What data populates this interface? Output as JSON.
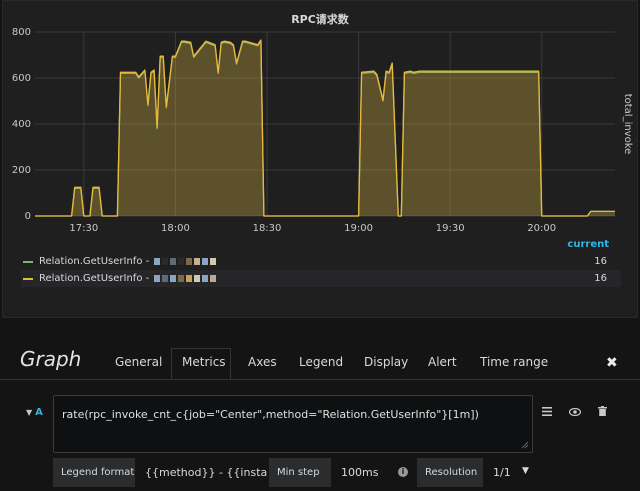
{
  "panel": {
    "title": "RPC请求数",
    "y2_label": "total_invoke",
    "legend_header": "current"
  },
  "chart_data": {
    "type": "area",
    "title": "RPC请求数",
    "ylabel": "total_invoke",
    "xlabel": "",
    "ylim": [
      0,
      800
    ],
    "y_ticks": [
      "0",
      "200",
      "400",
      "600",
      "800"
    ],
    "x_ticks": [
      "17:30",
      "18:00",
      "18:30",
      "19:00",
      "19:30",
      "20:00"
    ],
    "x_range": [
      "17:14",
      "20:24"
    ],
    "grid": true,
    "legend_placement": "bottom",
    "series": [
      {
        "name": "Relation.GetUserInfo -",
        "color": "#7eb26d",
        "current": "16",
        "x": [
          "17:14",
          "17:26",
          "17:27",
          "17:29",
          "17:30",
          "17:32",
          "17:33",
          "17:35",
          "17:36",
          "17:41",
          "17:42",
          "17:47",
          "17:48",
          "17:50",
          "17:51",
          "17:52",
          "17:53",
          "17:54",
          "17:55",
          "17:56",
          "17:57",
          "17:59",
          "18:00",
          "18:02",
          "18:03",
          "18:05",
          "18:06",
          "18:10",
          "18:11",
          "18:13",
          "18:14",
          "18:15",
          "18:16",
          "18:18",
          "18:19",
          "18:20",
          "18:22",
          "18:23",
          "18:27",
          "18:28",
          "18:29",
          "18:30",
          "18:50",
          "18:51",
          "18:52",
          "18:54",
          "18:55",
          "18:56",
          "18:57",
          "18:58",
          "18:59",
          "19:00",
          "19:01",
          "19:05",
          "19:06",
          "19:08",
          "19:09",
          "19:10",
          "19:11",
          "19:13",
          "19:14",
          "19:15",
          "19:17",
          "19:18",
          "19:20",
          "19:30",
          "19:40",
          "19:50",
          "19:59",
          "20:00",
          "20:01",
          "20:15",
          "20:16",
          "20:24"
        ],
        "values": [
          0,
          0,
          120,
          120,
          0,
          0,
          120,
          120,
          0,
          0,
          620,
          620,
          600,
          630,
          480,
          620,
          630,
          380,
          690,
          690,
          470,
          690,
          690,
          755,
          755,
          750,
          690,
          755,
          750,
          740,
          620,
          750,
          755,
          750,
          740,
          660,
          755,
          755,
          740,
          760,
          0,
          0,
          0,
          0,
          0,
          0,
          0,
          0,
          0,
          0,
          0,
          0,
          620,
          625,
          610,
          500,
          625,
          620,
          660,
          0,
          0,
          620,
          625,
          620,
          625,
          625,
          625,
          625,
          625,
          0,
          0,
          0,
          20,
          20
        ]
      },
      {
        "name": "Relation.GetUserInfo -",
        "color": "#eab839",
        "current": "16",
        "x": [
          "17:14",
          "17:26",
          "17:27",
          "17:29",
          "17:30",
          "17:32",
          "17:33",
          "17:35",
          "17:36",
          "17:41",
          "17:42",
          "17:47",
          "17:48",
          "17:50",
          "17:51",
          "17:52",
          "17:53",
          "17:54",
          "17:55",
          "17:56",
          "17:57",
          "17:59",
          "18:00",
          "18:02",
          "18:03",
          "18:05",
          "18:06",
          "18:10",
          "18:11",
          "18:13",
          "18:14",
          "18:15",
          "18:16",
          "18:18",
          "18:19",
          "18:20",
          "18:22",
          "18:23",
          "18:27",
          "18:28",
          "18:29",
          "18:30",
          "18:50",
          "18:51",
          "18:52",
          "18:54",
          "18:55",
          "18:56",
          "18:57",
          "18:58",
          "18:59",
          "19:00",
          "19:01",
          "19:05",
          "19:06",
          "19:08",
          "19:09",
          "19:10",
          "19:11",
          "19:13",
          "19:14",
          "19:15",
          "19:17",
          "19:18",
          "19:20",
          "19:30",
          "19:40",
          "19:50",
          "19:59",
          "20:00",
          "20:01",
          "20:15",
          "20:16",
          "20:24"
        ],
        "values": [
          0,
          0,
          125,
          125,
          0,
          0,
          125,
          125,
          0,
          0,
          625,
          625,
          605,
          635,
          485,
          625,
          635,
          385,
          695,
          695,
          475,
          695,
          695,
          760,
          760,
          755,
          695,
          760,
          755,
          745,
          625,
          755,
          760,
          755,
          745,
          665,
          760,
          760,
          745,
          765,
          0,
          0,
          0,
          0,
          0,
          0,
          0,
          0,
          0,
          0,
          0,
          0,
          625,
          630,
          615,
          505,
          630,
          625,
          665,
          0,
          0,
          625,
          630,
          625,
          630,
          630,
          630,
          630,
          630,
          0,
          0,
          0,
          20,
          20
        ]
      }
    ]
  },
  "editor": {
    "title": "Graph",
    "tabs": [
      "General",
      "Metrics",
      "Axes",
      "Legend",
      "Display",
      "Alert",
      "Time range"
    ],
    "close": "✖",
    "query_ref": "A",
    "query_text": "rate(rpc_invoke_cnt_c{job=\"Center\",method=\"Relation.GetUserInfo\"}[1m])",
    "legend_format_label": "Legend format",
    "legend_format_value": "{{method}} - {{instance",
    "min_step_label": "Min step",
    "min_step_value": "100ms",
    "resolution_label": "Resolution",
    "resolution_value": "1/1"
  }
}
